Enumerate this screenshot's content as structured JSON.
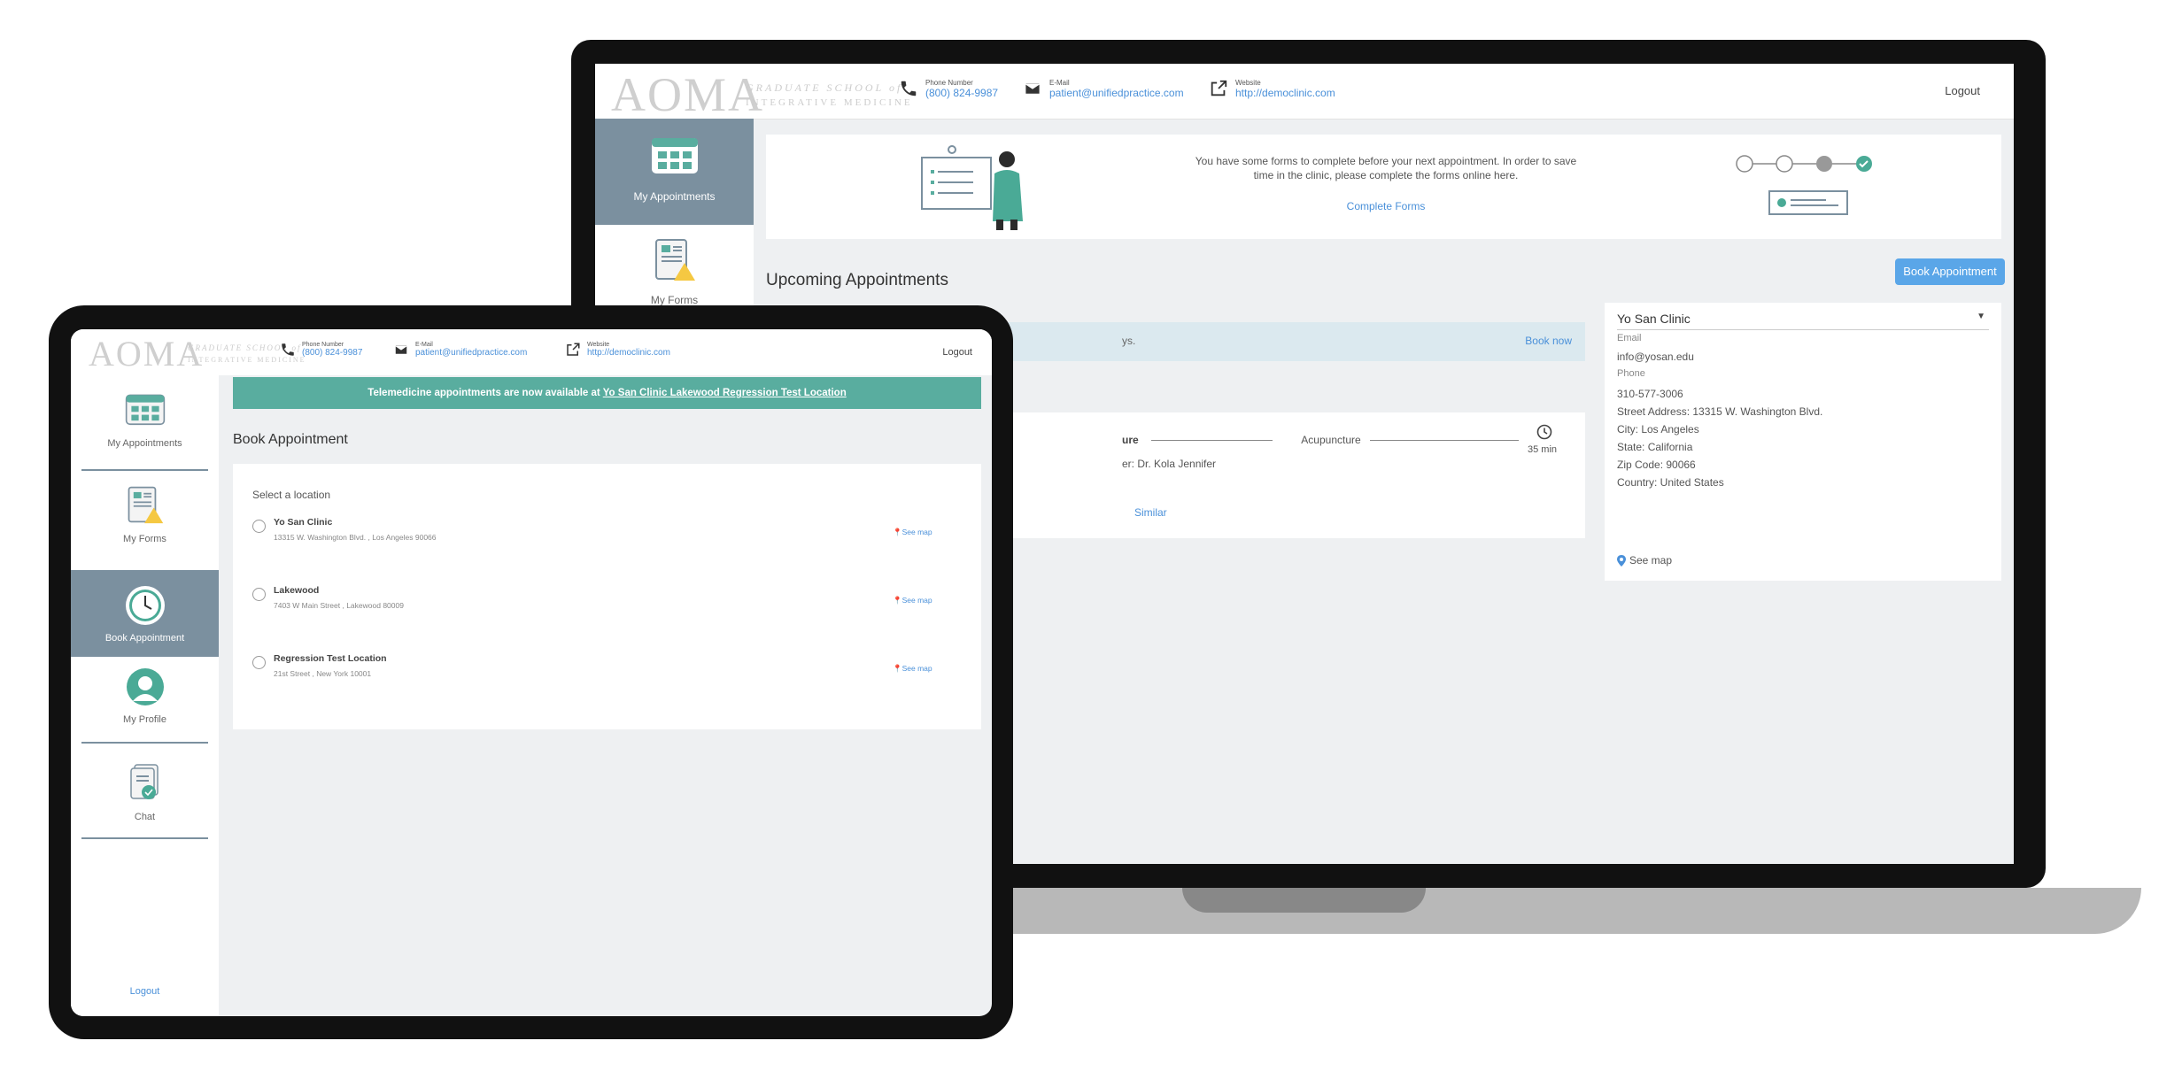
{
  "colors": {
    "accent": "#4a90d9",
    "teal": "#59ad9f",
    "sidebar_active": "#7b909f",
    "button": "#5aa6e8"
  },
  "brand": {
    "logo_text": "AOMA",
    "logo_sub_1": "GRADUATE SCHOOL of",
    "logo_sub_2": "INTEGRATIVE MEDICINE"
  },
  "header": {
    "phone_label": "Phone Number",
    "phone_value": "(800) 824-9987",
    "email_label": "E-Mail",
    "email_value": "patient@unifiedpractice.com",
    "website_label": "Website",
    "website_value": "http://democlinic.com",
    "logout": "Logout"
  },
  "laptop": {
    "sidebar": {
      "my_appointments": "My Appointments",
      "my_forms": "My Forms"
    },
    "forms_banner": {
      "text": "You have some forms to complete before your next appointment. In order to save time in the clinic, please complete the forms online here.",
      "link": "Complete Forms"
    },
    "upcoming_title": "Upcoming Appointments",
    "book_button": "Book Appointment",
    "notice": {
      "text": "ys.",
      "link": "Book now"
    },
    "appointment": {
      "partial_left": "ure",
      "service": "Acupuncture",
      "duration": "35 min",
      "provider": "er: Dr. Kola Jennifer",
      "similar": "Similar"
    },
    "clinic": {
      "selected": "Yo San Clinic",
      "email_label": "Email",
      "email": "info@yosan.edu",
      "phone_label": "Phone",
      "phone": "310-577-3006",
      "street": "Street Address: 13315 W. Washington Blvd.",
      "city": "City: Los Angeles",
      "state": "State: California",
      "zip": "Zip Code: 90066",
      "country": "Country: United States",
      "see_map": "See map"
    }
  },
  "tablet": {
    "sidebar": {
      "items": [
        {
          "label": "My Appointments"
        },
        {
          "label": "My Forms"
        },
        {
          "label": "Book Appointment"
        },
        {
          "label": "My Profile"
        },
        {
          "label": "Chat"
        }
      ],
      "logout": "Logout"
    },
    "banner": {
      "prefix": "Telemedicine appointments are now available at ",
      "link": "Yo San Clinic Lakewood Regression Test Location"
    },
    "page_title": "Book Appointment",
    "select_label": "Select a location",
    "locations": [
      {
        "name": "Yo San Clinic",
        "address": "13315 W. Washington Blvd. , Los Angeles 90066",
        "map": "See map"
      },
      {
        "name": "Lakewood",
        "address": "7403 W Main Street , Lakewood 80009",
        "map": "See map"
      },
      {
        "name": "Regression Test Location",
        "address": "21st Street , New York 10001",
        "map": "See map"
      }
    ]
  }
}
